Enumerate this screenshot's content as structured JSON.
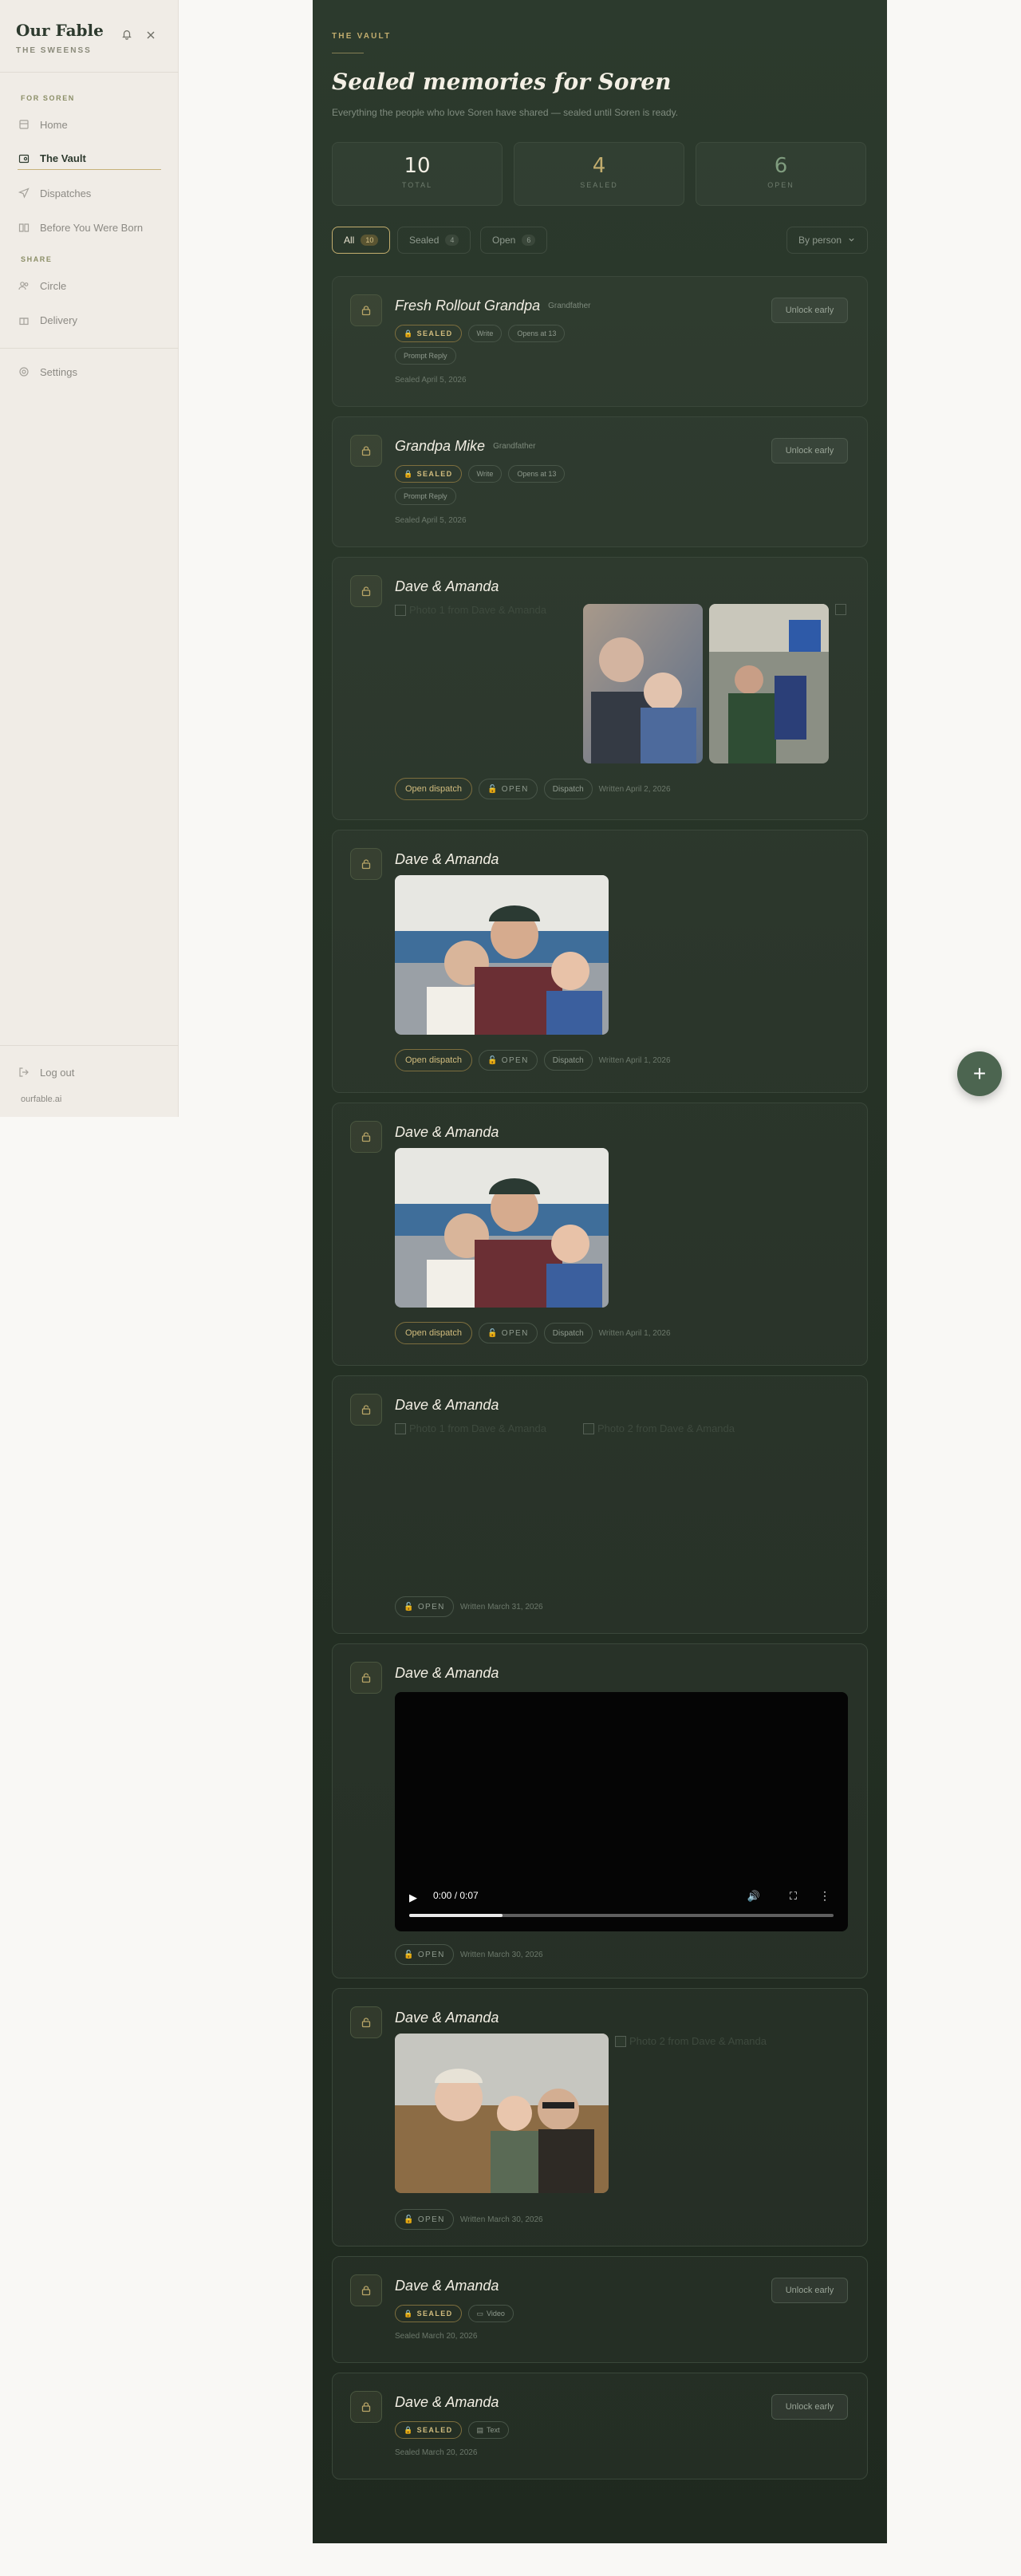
{
  "sidebar": {
    "brand": "Our Fable",
    "family": "THE SWEENSS",
    "section_for": "FOR SOREN",
    "section_share": "SHARE",
    "items": [
      {
        "label": "Home"
      },
      {
        "label": "The Vault"
      },
      {
        "label": "Dispatches"
      },
      {
        "label": "Before You Were Born"
      },
      {
        "label": "Circle"
      },
      {
        "label": "Delivery"
      },
      {
        "label": "Settings"
      }
    ],
    "logout": "Log out",
    "domain": "ourfable.ai"
  },
  "header": {
    "eyebrow": "THE VAULT",
    "title": "Sealed memories for Soren",
    "subtitle": "Everything the people who love Soren have shared — sealed until Soren is ready."
  },
  "stats": [
    {
      "value": "10",
      "label": "TOTAL",
      "color": "#f3efe4"
    },
    {
      "value": "4",
      "label": "SEALED",
      "color": "#c2ad6e"
    },
    {
      "value": "6",
      "label": "OPEN",
      "color": "#7f9c7e"
    }
  ],
  "filters": [
    {
      "label": "All",
      "count": "10"
    },
    {
      "label": "Sealed",
      "count": "4"
    },
    {
      "label": "Open",
      "count": "6"
    }
  ],
  "sort_label": "By person",
  "labels": {
    "unlock": "Unlock early",
    "sealed": "SEALED",
    "open": "OPEN",
    "open_dispatch": "Open dispatch",
    "dispatch": "Dispatch",
    "write": "Write",
    "prompt_reply": "Prompt Reply",
    "video_kind": "Video",
    "text_kind": "Text"
  },
  "cards": [
    {
      "name": "Fresh Rollout Grandpa",
      "relation": "Grandfather",
      "opens": "Opens at 13",
      "meta": "Sealed April 5, 2026"
    },
    {
      "name": "Grandpa Mike",
      "relation": "Grandfather",
      "opens": "Opens at 13",
      "meta": "Sealed April 5, 2026"
    },
    {
      "name": "Dave & Amanda",
      "meta": "Written April 2, 2026",
      "broken_alt": "Photo 1 from Dave & Amanda"
    },
    {
      "name": "Dave & Amanda",
      "meta": "Written April 1, 2026"
    },
    {
      "name": "Dave & Amanda",
      "meta": "Written April 1, 2026"
    },
    {
      "name": "Dave & Amanda",
      "meta": "Written March 31, 2026",
      "broken_alt_1": "Photo 1 from Dave & Amanda",
      "broken_alt_2": "Photo 2 from Dave & Amanda"
    },
    {
      "name": "Dave & Amanda",
      "meta": "Written March 30, 2026",
      "video_time": "0:00 / 0:07",
      "video_progress": 0.22
    },
    {
      "name": "Dave & Amanda",
      "meta": "Written March 30, 2026",
      "broken_alt": "Photo 2 from Dave & Amanda"
    },
    {
      "name": "Dave & Amanda",
      "meta": "Sealed March 20, 2026"
    },
    {
      "name": "Dave & Amanda",
      "meta": "Sealed March 20, 2026"
    }
  ],
  "colors": {
    "accent": "#c2ad6e",
    "main_bg": "#263226",
    "fab": "#4c6550"
  }
}
